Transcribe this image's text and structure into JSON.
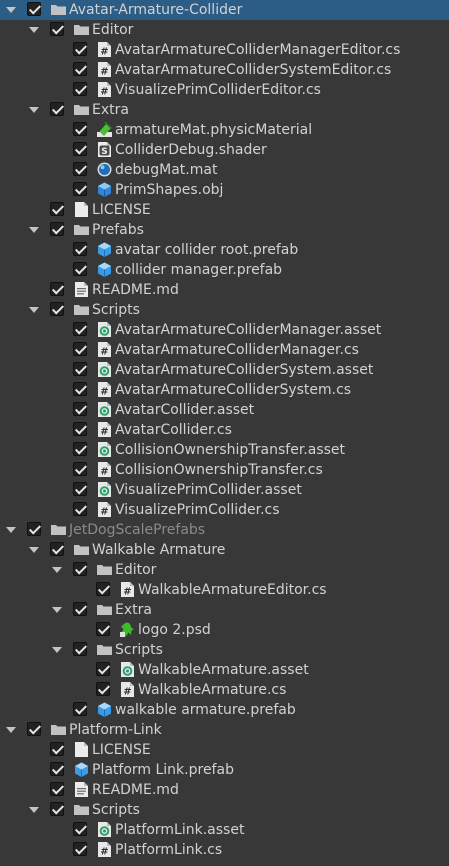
{
  "colors": {
    "background": "#383838",
    "selection": "#2c5d87",
    "text": "#d2d2d2",
    "dim_text": "#8a8a8a"
  },
  "tree": [
    {
      "label": "Avatar-Armature-Collider",
      "depth": 0,
      "icon": "folder-icon",
      "expanded": true,
      "checked": true,
      "selected": true
    },
    {
      "label": "Editor",
      "depth": 1,
      "icon": "folder-icon",
      "expanded": true,
      "checked": true
    },
    {
      "label": "AvatarArmatureColliderManagerEditor.cs",
      "depth": 2,
      "icon": "csharp-script-icon",
      "checked": true
    },
    {
      "label": "AvatarArmatureColliderSystemEditor.cs",
      "depth": 2,
      "icon": "csharp-script-icon",
      "checked": true
    },
    {
      "label": "VisualizePrimColliderEditor.cs",
      "depth": 2,
      "icon": "csharp-script-icon",
      "checked": true
    },
    {
      "label": "Extra",
      "depth": 1,
      "icon": "folder-icon",
      "expanded": true,
      "checked": true
    },
    {
      "label": "armatureMat.physicMaterial",
      "depth": 2,
      "icon": "physic-material-icon",
      "checked": true
    },
    {
      "label": "ColliderDebug.shader",
      "depth": 2,
      "icon": "shader-icon",
      "checked": true
    },
    {
      "label": "debugMat.mat",
      "depth": 2,
      "icon": "material-icon",
      "checked": true
    },
    {
      "label": "PrimShapes.obj",
      "depth": 2,
      "icon": "mesh-icon",
      "checked": true
    },
    {
      "label": "LICENSE",
      "depth": 1,
      "icon": "file-icon",
      "checked": true
    },
    {
      "label": "Prefabs",
      "depth": 1,
      "icon": "folder-icon",
      "expanded": true,
      "checked": true
    },
    {
      "label": "avatar collider root.prefab",
      "depth": 2,
      "icon": "prefab-icon",
      "checked": true
    },
    {
      "label": "collider manager.prefab",
      "depth": 2,
      "icon": "prefab-icon",
      "checked": true
    },
    {
      "label": "README.md",
      "depth": 1,
      "icon": "text-file-icon",
      "checked": true
    },
    {
      "label": "Scripts",
      "depth": 1,
      "icon": "folder-icon",
      "expanded": true,
      "checked": true
    },
    {
      "label": "AvatarArmatureColliderManager.asset",
      "depth": 2,
      "icon": "udon-asset-icon",
      "checked": true
    },
    {
      "label": "AvatarArmatureColliderManager.cs",
      "depth": 2,
      "icon": "csharp-script-icon",
      "checked": true
    },
    {
      "label": "AvatarArmatureColliderSystem.asset",
      "depth": 2,
      "icon": "udon-asset-icon",
      "checked": true
    },
    {
      "label": "AvatarArmatureColliderSystem.cs",
      "depth": 2,
      "icon": "csharp-script-icon",
      "checked": true
    },
    {
      "label": "AvatarCollider.asset",
      "depth": 2,
      "icon": "udon-asset-icon",
      "checked": true
    },
    {
      "label": "AvatarCollider.cs",
      "depth": 2,
      "icon": "csharp-script-icon",
      "checked": true
    },
    {
      "label": "CollisionOwnershipTransfer.asset",
      "depth": 2,
      "icon": "udon-asset-icon",
      "checked": true
    },
    {
      "label": "CollisionOwnershipTransfer.cs",
      "depth": 2,
      "icon": "csharp-script-icon",
      "checked": true
    },
    {
      "label": "VisualizePrimCollider.asset",
      "depth": 2,
      "icon": "udon-asset-icon",
      "checked": true
    },
    {
      "label": "VisualizePrimCollider.cs",
      "depth": 2,
      "icon": "csharp-script-icon",
      "checked": true
    },
    {
      "label": "JetDogScalePrefabs",
      "depth": 0,
      "icon": "folder-icon",
      "expanded": true,
      "checked": true,
      "dim": true
    },
    {
      "label": "Walkable Armature",
      "depth": 1,
      "icon": "folder-icon",
      "expanded": true,
      "checked": true
    },
    {
      "label": "Editor",
      "depth": 2,
      "icon": "folder-icon",
      "expanded": true,
      "checked": true
    },
    {
      "label": "WalkableArmatureEditor.cs",
      "depth": 3,
      "icon": "csharp-script-icon",
      "checked": true
    },
    {
      "label": "Extra",
      "depth": 2,
      "icon": "folder-icon",
      "expanded": true,
      "checked": true
    },
    {
      "label": "logo 2.psd",
      "depth": 3,
      "icon": "texture-icon",
      "checked": true
    },
    {
      "label": "Scripts",
      "depth": 2,
      "icon": "folder-icon",
      "expanded": true,
      "checked": true
    },
    {
      "label": "WalkableArmature.asset",
      "depth": 3,
      "icon": "udon-asset-icon",
      "checked": true
    },
    {
      "label": "WalkableArmature.cs",
      "depth": 3,
      "icon": "csharp-script-icon",
      "checked": true
    },
    {
      "label": "walkable armature.prefab",
      "depth": 2,
      "icon": "prefab-icon",
      "checked": true
    },
    {
      "label": "Platform-Link",
      "depth": 0,
      "icon": "folder-icon",
      "expanded": true,
      "checked": true
    },
    {
      "label": "LICENSE",
      "depth": 1,
      "icon": "file-icon",
      "checked": true
    },
    {
      "label": "Platform Link.prefab",
      "depth": 1,
      "icon": "prefab-icon",
      "checked": true
    },
    {
      "label": "README.md",
      "depth": 1,
      "icon": "text-file-icon",
      "checked": true
    },
    {
      "label": "Scripts",
      "depth": 1,
      "icon": "folder-icon",
      "expanded": true,
      "checked": true
    },
    {
      "label": "PlatformLink.asset",
      "depth": 2,
      "icon": "udon-asset-icon",
      "checked": true
    },
    {
      "label": "PlatformLink.cs",
      "depth": 2,
      "icon": "csharp-script-icon",
      "checked": true
    }
  ]
}
